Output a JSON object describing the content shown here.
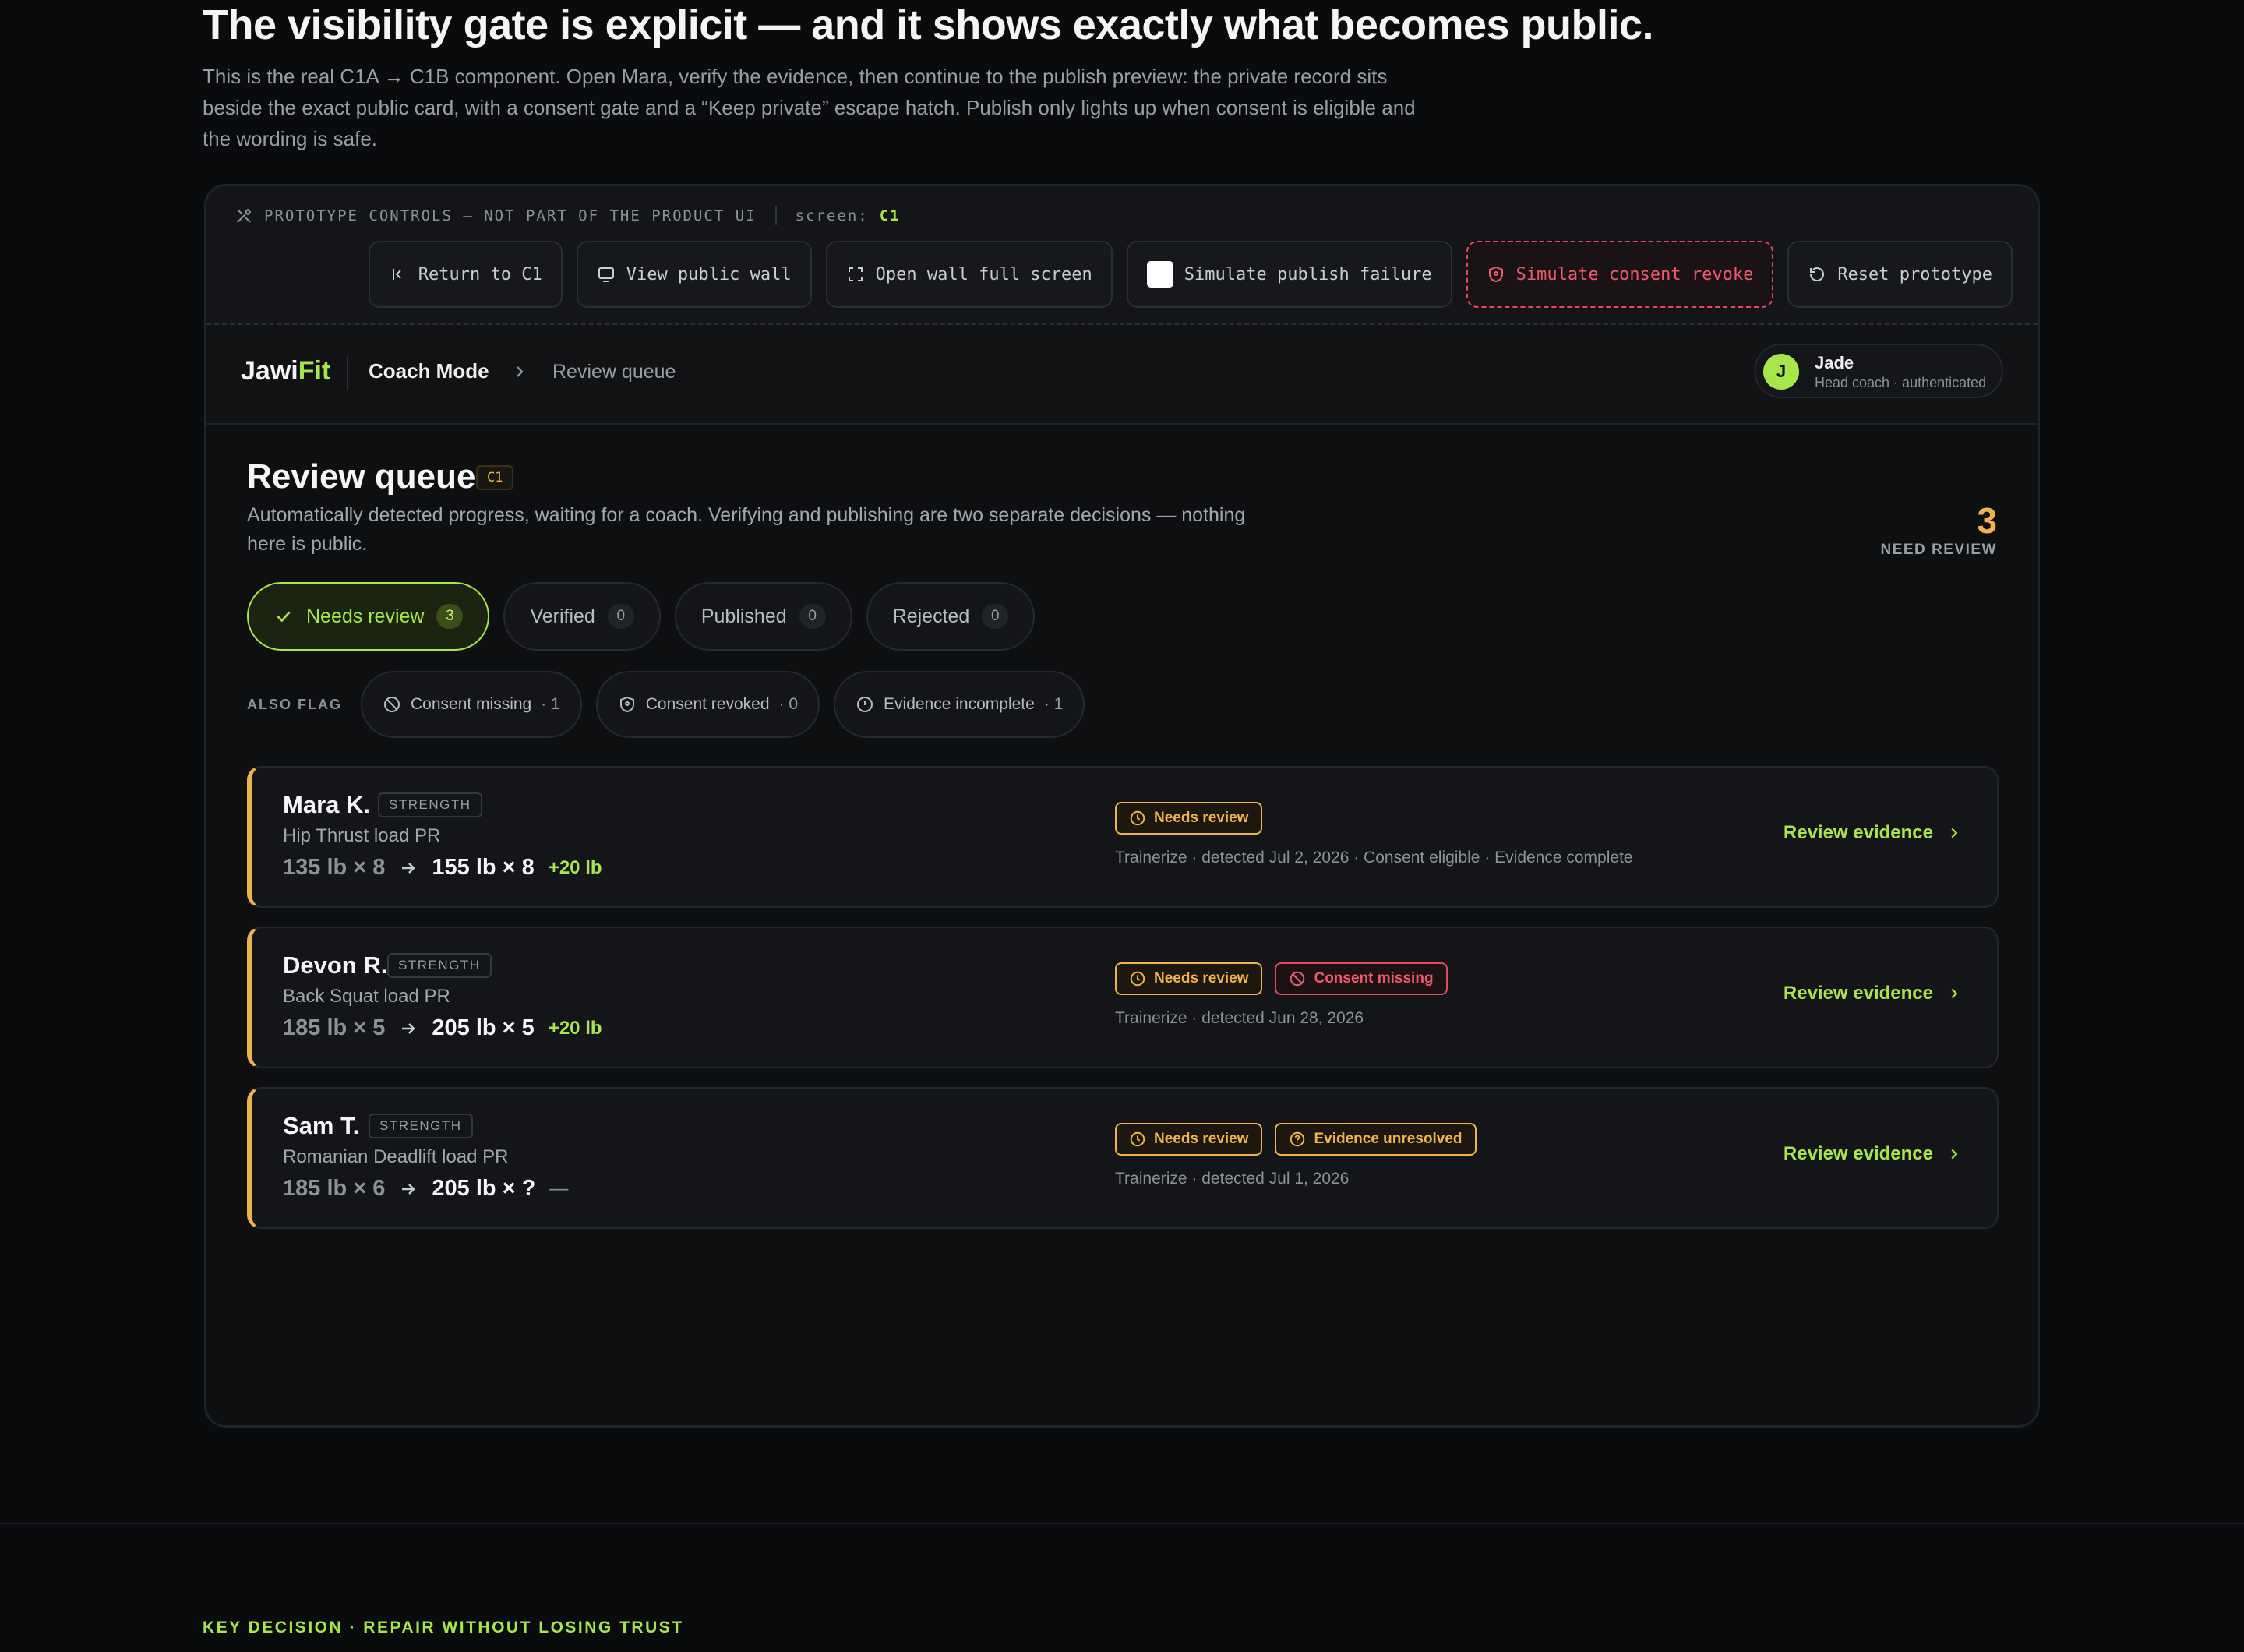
{
  "hero": {
    "title": "The visibility gate is explicit — and it shows exactly what becomes public.",
    "subtitle": "This is the real C1A → C1B component. Open Mara, verify the evidence, then continue to the publish preview: the private record sits beside the exact public card, with a consent gate and a “Keep private” escape hatch. Publish only lights up when consent is eligible and the wording is safe."
  },
  "prototype": {
    "label": "PROTOTYPE CONTROLS — NOT PART OF THE PRODUCT UI",
    "screen_label": "screen:",
    "screen_value": "C1",
    "buttons": {
      "return": "Return to C1",
      "view_wall": "View public wall",
      "open_full": "Open wall full screen",
      "sim_failure": "Simulate publish failure",
      "sim_revoke": "Simulate consent revoke",
      "reset": "Reset prototype"
    },
    "icons": [
      "tools-icon",
      "return-icon",
      "monitor-icon",
      "fullscreen-icon",
      "checkbox",
      "shield-icon",
      "reset-icon"
    ],
    "colors": {
      "danger": "#e5485b",
      "accent": "#a7e64b"
    }
  },
  "nav": {
    "brand_a": "Jawi",
    "brand_b": "Fit",
    "mode": "Coach Mode",
    "crumb": "Review queue",
    "user": {
      "initial": "J",
      "name": "Jade",
      "role": "Head coach · authenticated"
    }
  },
  "queue": {
    "title": "Review queue",
    "tag": "C1",
    "description": "Automatically detected progress, waiting for a coach. Verifying and publishing are two separate decisions — nothing here is public.",
    "need_count": "3",
    "need_label": "NEED REVIEW",
    "tabs": [
      {
        "label": "Needs review",
        "count": "3",
        "active": true
      },
      {
        "label": "Verified",
        "count": "0"
      },
      {
        "label": "Published",
        "count": "0"
      },
      {
        "label": "Rejected",
        "count": "0"
      }
    ],
    "flags_title": "ALSO FLAG",
    "flags": [
      {
        "label": "Consent missing",
        "count": "· 1",
        "icon": "ban-icon"
      },
      {
        "label": "Consent revoked",
        "count": "· 0",
        "icon": "shield-icon"
      },
      {
        "label": "Evidence incomplete",
        "count": "· 1",
        "icon": "info-icon"
      }
    ],
    "items": [
      {
        "name": "Mara K.",
        "category": "STRENGTH",
        "lift": "Hip Thrust load PR",
        "from": "135 lb × 8",
        "to": "155 lb × 8",
        "delta": "+20 lb",
        "badges": [
          {
            "label": "Needs review",
            "kind": "warn",
            "icon": "clock-icon"
          }
        ],
        "meta": "Trainerize · detected Jul 2, 2026 · Consent eligible · Evidence complete",
        "action": "Review evidence"
      },
      {
        "name": "Devon R.",
        "category": "STRENGTH",
        "lift": "Back Squat load PR",
        "from": "185 lb × 5",
        "to": "205 lb × 5",
        "delta": "+20 lb",
        "badges": [
          {
            "label": "Needs review",
            "kind": "warn",
            "icon": "clock-icon"
          },
          {
            "label": "Consent missing",
            "kind": "err",
            "icon": "ban-icon"
          }
        ],
        "meta": "Trainerize · detected Jun 28, 2026",
        "action": "Review evidence"
      },
      {
        "name": "Sam T.",
        "category": "STRENGTH",
        "lift": "Romanian Deadlift load PR",
        "from": "185 lb × 6",
        "to": "205 lb × ?",
        "delta": "—",
        "badges": [
          {
            "label": "Needs review",
            "kind": "warn",
            "icon": "clock-icon"
          },
          {
            "label": "Evidence unresolved",
            "kind": "warn",
            "icon": "question-icon"
          }
        ],
        "meta": "Trainerize · detected Jul 1, 2026",
        "action": "Review evidence"
      }
    ]
  },
  "footer": {
    "key_decision": "KEY DECISION · REPAIR WITHOUT LOSING TRUST"
  },
  "colors": {
    "warn": "#f0b34b",
    "accent": "#a7e64b",
    "error": "#e5485b",
    "bg": "#0a0b0d"
  }
}
